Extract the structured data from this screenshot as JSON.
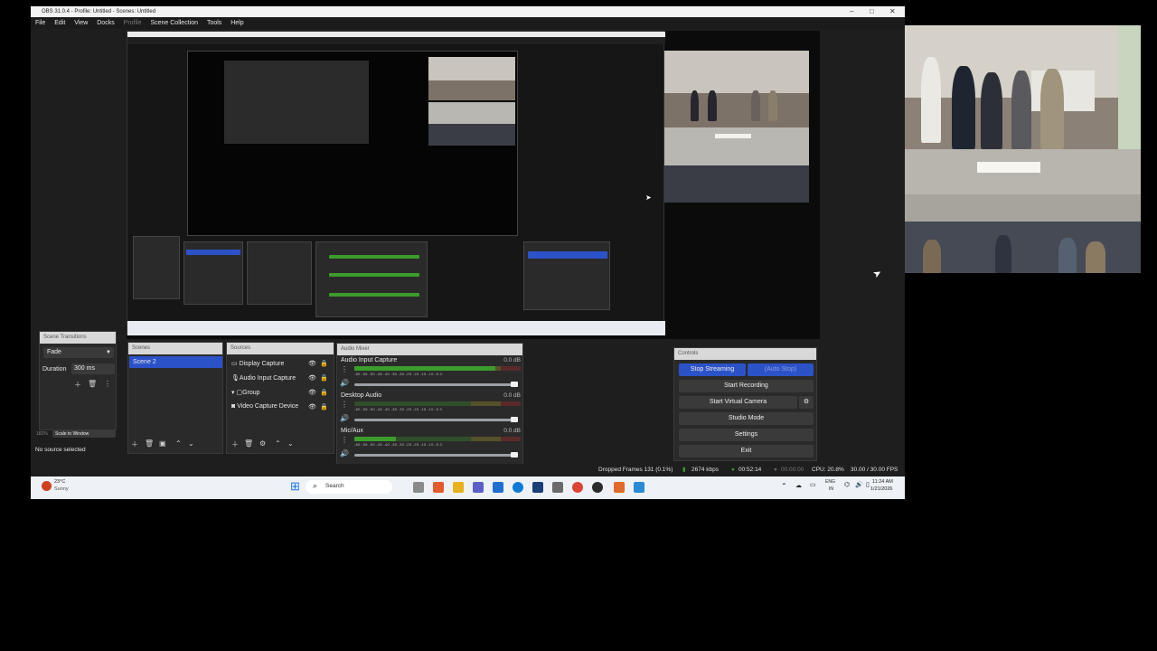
{
  "window": {
    "title": "OBS 31.0.4 - Profile: Untitled - Scenes: Untitled",
    "controls": [
      "–",
      "□",
      "✕"
    ]
  },
  "menu": [
    "File",
    "Edit",
    "View",
    "Docks",
    "Profile",
    "Scene Collection",
    "Tools",
    "Help"
  ],
  "transitions": {
    "header": "Scene Transitions",
    "type": "Fade",
    "duration_label": "Duration",
    "duration_value": "300 ms"
  },
  "scenes": {
    "header": "Scenes",
    "items": [
      "Scene 2"
    ]
  },
  "sources": {
    "header": "Sources",
    "items": [
      "Display Capture",
      "Audio Input Capture",
      "Group",
      "Video Capture Device"
    ]
  },
  "mixer": {
    "header": "Audio Mixer",
    "scale": "-60 -55 -50 -45 -40 -35 -30 -25 -20 -15 -10 -5 0",
    "channels": [
      {
        "name": "Audio Input Capture",
        "db": "0.0 dB",
        "level": 0.85
      },
      {
        "name": "Desktop Audio",
        "db": "0.0 dB",
        "level": 0.0
      },
      {
        "name": "Mic/Aux",
        "db": "0.0 dB",
        "level": 0.25
      }
    ]
  },
  "controls": {
    "header": "Controls",
    "stop_streaming": "Stop Streaming",
    "auto_stop": "(Auto Stop)",
    "start_recording": "Start Recording",
    "start_virtual_camera": "Start Virtual Camera",
    "studio_mode": "Studio Mode",
    "settings": "Settings",
    "exit": "Exit"
  },
  "left_footer": {
    "zoom": "182%",
    "scale_mode": "Scale to Window",
    "no_source": "No source selected"
  },
  "status": {
    "dropped_frames": "Dropped Frames 131 (0.1%)",
    "bitrate": "2674 kbps",
    "stream_time": "00:52:14",
    "rec_time": "00:00:00",
    "cpu": "CPU: 20.8%",
    "fps": "30.00 / 30.00 FPS"
  },
  "taskbar": {
    "weather_temp": "23°C",
    "weather_desc": "Sunny",
    "search_placeholder": "Search",
    "lang": "ENG",
    "region": "IN",
    "time": "11:24 AM",
    "date": "1/21/2026"
  },
  "colors": {
    "accent_blue": "#2c52c8",
    "meter_green": "#3c9c2c",
    "meter_yellow": "#8c8a2c",
    "meter_red": "#8c2c2c"
  }
}
